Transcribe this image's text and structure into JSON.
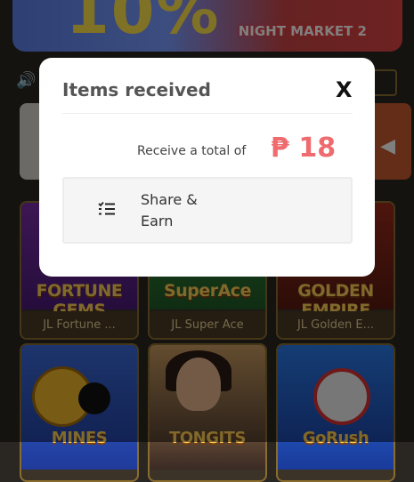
{
  "background": {
    "banner_promo": "10%",
    "banner_event": "NIGHT MARKET 2",
    "games": [
      {
        "logo": "FORTUNE GEMS",
        "title": "JL Fortune ..."
      },
      {
        "logo": "SuperAce",
        "title": "JL Super Ace"
      },
      {
        "logo": "GOLDEN EMPIRE",
        "title": "JL Golden E..."
      },
      {
        "logo": "MINES",
        "title": ""
      },
      {
        "logo": "TONGITS",
        "title": ""
      },
      {
        "logo": "GoRush",
        "title": ""
      }
    ]
  },
  "modal": {
    "title": "Items received",
    "close_label": "X",
    "total_label": "Receive a total of",
    "total_amount": "₱ 18",
    "reward_item": {
      "icon": "list-icon",
      "label": "Share & Earn"
    }
  },
  "colors": {
    "amount": "#ef6b6f",
    "overlay": "rgba(0,0,0,0.5)"
  }
}
